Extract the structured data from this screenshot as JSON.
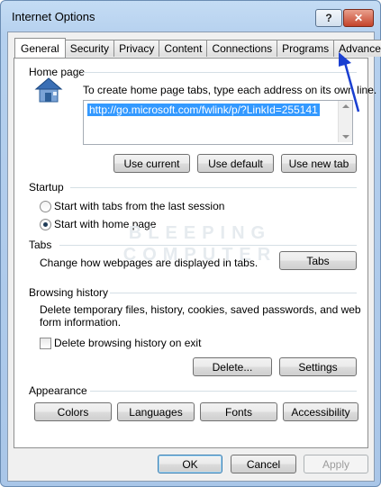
{
  "window": {
    "title": "Internet Options",
    "help_label": "?",
    "close_label": "✕"
  },
  "tabs": [
    {
      "label": "General"
    },
    {
      "label": "Security"
    },
    {
      "label": "Privacy"
    },
    {
      "label": "Content"
    },
    {
      "label": "Connections"
    },
    {
      "label": "Programs"
    },
    {
      "label": "Advanced"
    }
  ],
  "home_page": {
    "heading": "Home page",
    "instruction": "To create home page tabs, type each address on its own line.",
    "url": "http://go.microsoft.com/fwlink/p/?LinkId=255141",
    "buttons": {
      "use_current": "Use current",
      "use_default": "Use default",
      "use_new_tab": "Use new tab"
    }
  },
  "startup": {
    "heading": "Startup",
    "options": [
      {
        "label": "Start with tabs from the last session",
        "selected": false
      },
      {
        "label": "Start with home page",
        "selected": true
      }
    ]
  },
  "tabs_section": {
    "heading": "Tabs",
    "description": "Change how webpages are displayed in tabs.",
    "button": "Tabs"
  },
  "browsing_history": {
    "heading": "Browsing history",
    "description_line1": "Delete temporary files, history, cookies, saved passwords, and web",
    "description_line2": "form information.",
    "checkbox_label": "Delete browsing history on exit",
    "checkbox_checked": false,
    "delete_button": "Delete...",
    "settings_button": "Settings"
  },
  "appearance": {
    "heading": "Appearance",
    "buttons": [
      "Colors",
      "Languages",
      "Fonts",
      "Accessibility"
    ]
  },
  "watermark": {
    "line1": "BLEEPING",
    "line2": "COMPUTER"
  },
  "footer": {
    "ok": "OK",
    "cancel": "Cancel",
    "apply": "Apply"
  },
  "colors": {
    "annotation_arrow": "#1a3fd1",
    "selection": "#3399ff"
  },
  "icons": {
    "home": "house-icon",
    "annotation": "arrow-annotation-icon"
  }
}
